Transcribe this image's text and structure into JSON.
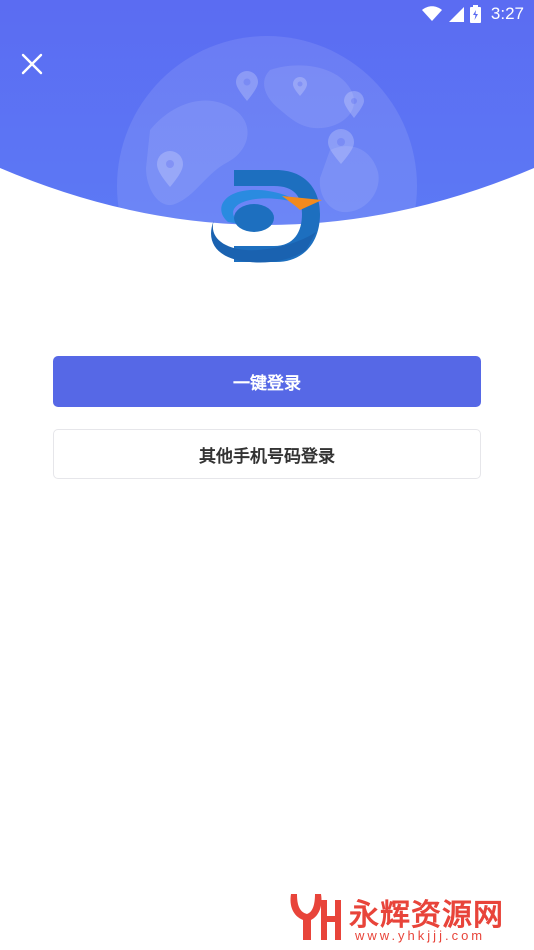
{
  "status_bar": {
    "time": "3:27",
    "icons": [
      "wifi-icon",
      "cell-signal-icon",
      "battery-icon"
    ]
  },
  "header": {
    "close_icon": "close-icon"
  },
  "actions": {
    "one_click_login": "一键登录",
    "other_phone_login": "其他手机号码登录"
  },
  "watermark": {
    "text": "永辉资源网",
    "url": "www.yhkjjj.com"
  },
  "colors": {
    "header_gradient_start": "#5b6cf2",
    "header_gradient_end": "#5c79f5",
    "primary_button": "#5668e6",
    "watermark": "#e8443a"
  }
}
